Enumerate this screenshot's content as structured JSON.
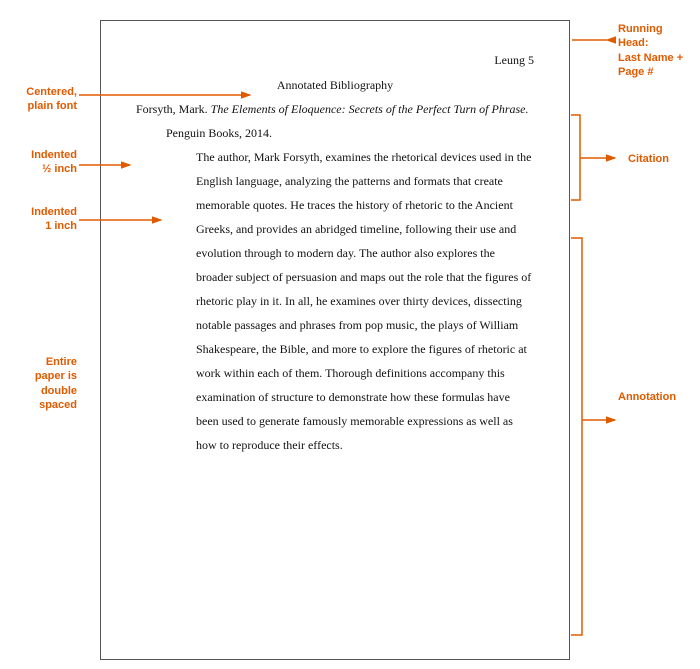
{
  "labels": {
    "centered": "Centered,\nplain font",
    "half_inch": "Indented\n½ inch",
    "one_inch": "Indented\n1 inch",
    "double_spaced": "Entire\npaper is\ndouble\nspaced",
    "running_head": "Running\nHead:\nLast Name +\nPage #",
    "citation": "Citation",
    "annotation": "Annotation"
  },
  "paper": {
    "header": "Leung 5",
    "title": "Annotated Bibliography",
    "citation_author": "Forsyth, Mark.",
    "citation_title": "The Elements of Eloquence: Secrets of the Perfect Turn of Phrase.",
    "citation_rest": " Penguin Books, 2014.",
    "annotation": "The author, Mark Forsyth, examines the rhetorical devices used in the English language, analyzing the patterns and formats that create memorable quotes. He traces the history of rhetoric to the Ancient Greeks, and provides an abridged timeline, following their use and evolution through to modern day. The author also explores the broader subject of persuasion and maps out the role that the figures of rhetoric play in it. In all, he examines over thirty devices, dissecting notable passages and phrases from pop music, the plays of William Shakespeare, the Bible, and more to explore the figures of rhetoric at work within each of them. Thorough definitions accompany this examination of structure to demonstrate how these formulas have been used to generate famously memorable expressions as well as how to reproduce their effects."
  }
}
